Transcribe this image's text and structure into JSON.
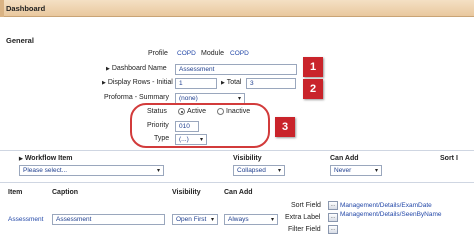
{
  "title": "Dashboard",
  "section_title": "General",
  "profile": {
    "label": "Profile",
    "value": "COPD"
  },
  "module": {
    "label": "Module",
    "value": "COPD"
  },
  "dashboard_name": {
    "label": "Dashboard Name",
    "value": "Assessment"
  },
  "display_rows": {
    "label": "Display Rows - Initial",
    "value": "1"
  },
  "total": {
    "label": "Total",
    "value": "3"
  },
  "proforma": {
    "label": "Proforma - Summary",
    "value": "(none)"
  },
  "status": {
    "label": "Status",
    "options": [
      "Active",
      "Inactive"
    ],
    "selected": "Active"
  },
  "priority": {
    "label": "Priority",
    "value": "010"
  },
  "type": {
    "label": "Type",
    "value": "(...)"
  },
  "badges": [
    "1",
    "2",
    "3"
  ],
  "workflow": {
    "headers": {
      "item": "Workflow Item",
      "visibility": "Visibility",
      "can_add": "Can Add",
      "sort": "Sort I"
    },
    "item_value": "Please select...",
    "visibility_value": "Collapsed",
    "can_add_value": "Never"
  },
  "items": {
    "headers": {
      "item": "Item",
      "caption": "Caption",
      "visibility": "Visibility",
      "can_add": "Can Add"
    },
    "row": {
      "item": "Assessment",
      "caption": "Assessment",
      "visibility": "Open First",
      "can_add": "Always",
      "sort_field_label": "Sort Field",
      "sort_field_value": "Management/Details/ExamDate",
      "extra_label_label": "Extra Label",
      "extra_label_value": "Management/Details/SeenByName",
      "filter_field_label": "Filter Field",
      "button_label": "..."
    }
  },
  "colors": {
    "accent_red": "#c9242b",
    "titlebar": "#e9c89e",
    "link": "#2348a8"
  }
}
